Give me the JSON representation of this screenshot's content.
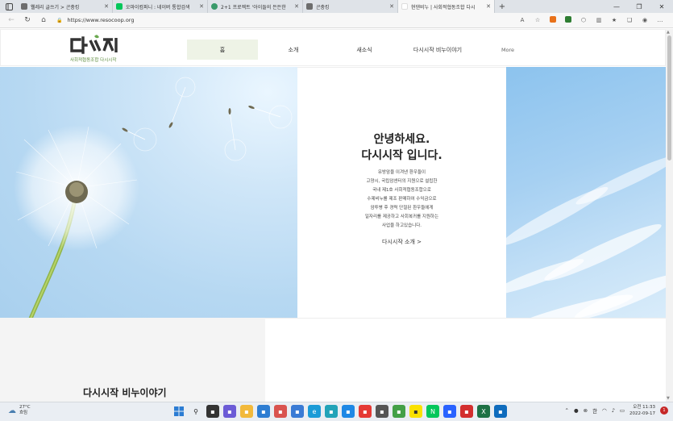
{
  "browser": {
    "tabs": [
      {
        "title": "웰레리 글쓰기 > 곤충킹",
        "favicon_color": "#6d6d6d"
      },
      {
        "title": "오마이컴퍼니 : 네이버 통합검색",
        "favicon_color": "#03c75a"
      },
      {
        "title": "2+1 프로젝트 '아이들의 든든한",
        "favicon_color": "#3a9a6a"
      },
      {
        "title": "곤충킹",
        "favicon_color": "#6d6d6d"
      },
      {
        "title": "현댄비누 | 사회적협동조합 다시",
        "favicon_color": "#ffffff"
      }
    ],
    "active_tab": 4,
    "url": "https://www.resocoop.org"
  },
  "site": {
    "logo_text": "다시시작",
    "logo_sub": "사회적협동조합 다시시작",
    "menu": [
      "홈",
      "소개",
      "새소식",
      "다시시작 비누이야기",
      "More"
    ],
    "hero": {
      "title1": "안녕하세요.",
      "title2": "다시시작 입니다.",
      "body": [
        "유방암을 이겨낸 환우들이",
        "고양시, 국립암센터의 지원으로 설립한",
        "국내 제1호 사회적협동조합으로",
        "수제비누를 제조 판매하여 수익금으로",
        "암투병 후 경력 단절된 환우들에게",
        "일자리를 제공하고 사회복귀를 지원하는",
        "사업을 하고있습니다."
      ],
      "link": "다시시작 소개 >"
    },
    "story_title": "다시시작 비누이야기"
  },
  "taskbar": {
    "weather_temp": "27°C",
    "weather_desc": "흐림",
    "lang": "한",
    "time": "오전 11:33",
    "date": "2022-09-17",
    "notifications": "1"
  },
  "colors": {
    "menu_active_bg": "#eef3e6",
    "logo_green": "#5a8a3a"
  }
}
